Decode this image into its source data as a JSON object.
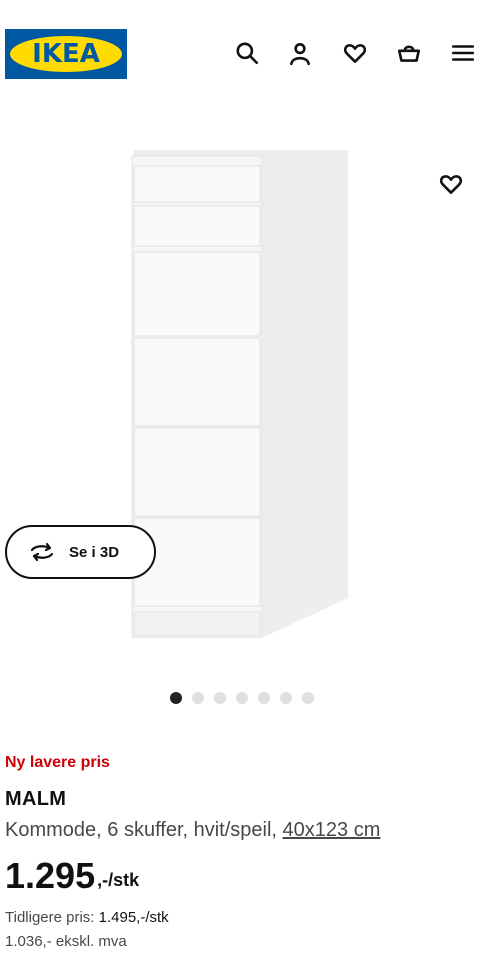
{
  "header": {
    "logo_text": "IKEA",
    "icons": [
      "search-icon",
      "user-icon",
      "heart-icon",
      "basket-icon",
      "menu-icon"
    ]
  },
  "gallery": {
    "favourite_icon": "heart-icon",
    "view_3d_label": "Se i 3D",
    "view_3d_icon": "rotate-3d-icon",
    "slide_count": 7,
    "active_slide": 1
  },
  "product": {
    "badge": "Ny lavere pris",
    "name": "MALM",
    "description": "Kommode, 6 skuffer, hvit/speil, ",
    "size": "40x123 cm",
    "price": "1.295",
    "price_unit": ",-/stk",
    "previous_price_label": "Tidligere pris: ",
    "previous_price_value": "1.495,-/stk",
    "price_ex_vat": "1.036,- ekskl. mva"
  },
  "colors": {
    "brand_blue": "#0058a3",
    "brand_yellow": "#ffdb00",
    "badge_red": "#cc0008"
  }
}
